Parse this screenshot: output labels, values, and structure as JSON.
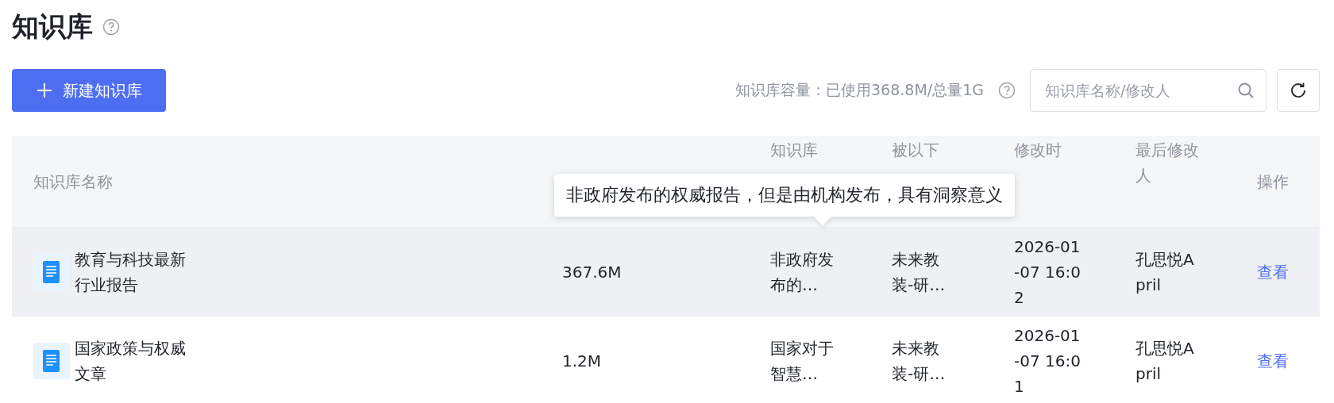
{
  "page_title": "知识库",
  "new_button": {
    "label": "新建知识库"
  },
  "capacity": "知识库容量：已使用368.8M/总量1G",
  "search": {
    "placeholder": "知识库名称/修改人"
  },
  "table": {
    "columns": [
      "知识库名称",
      "知识库",
      "被以下",
      "修改时",
      "最后修改人",
      "操作"
    ],
    "rows": [
      {
        "name": "教育与科技最新行业报告",
        "size": "367.6M",
        "description": "非政府发布的…",
        "used_by": "未来教装-研…",
        "modified": "2026-01-07 16:02",
        "modifier": "孔思悦April",
        "action": "查看",
        "selected": true
      },
      {
        "name": "国家政策与权威文章",
        "size": "1.2M",
        "description": "国家对于智慧…",
        "used_by": "未来教装-研…",
        "modified": "2026-01-07 16:01",
        "modifier": "孔思悦April",
        "action": "查看",
        "selected": false
      }
    ]
  },
  "tooltip": "非政府发布的权威报告，但是由机构发布，具有洞察意义"
}
